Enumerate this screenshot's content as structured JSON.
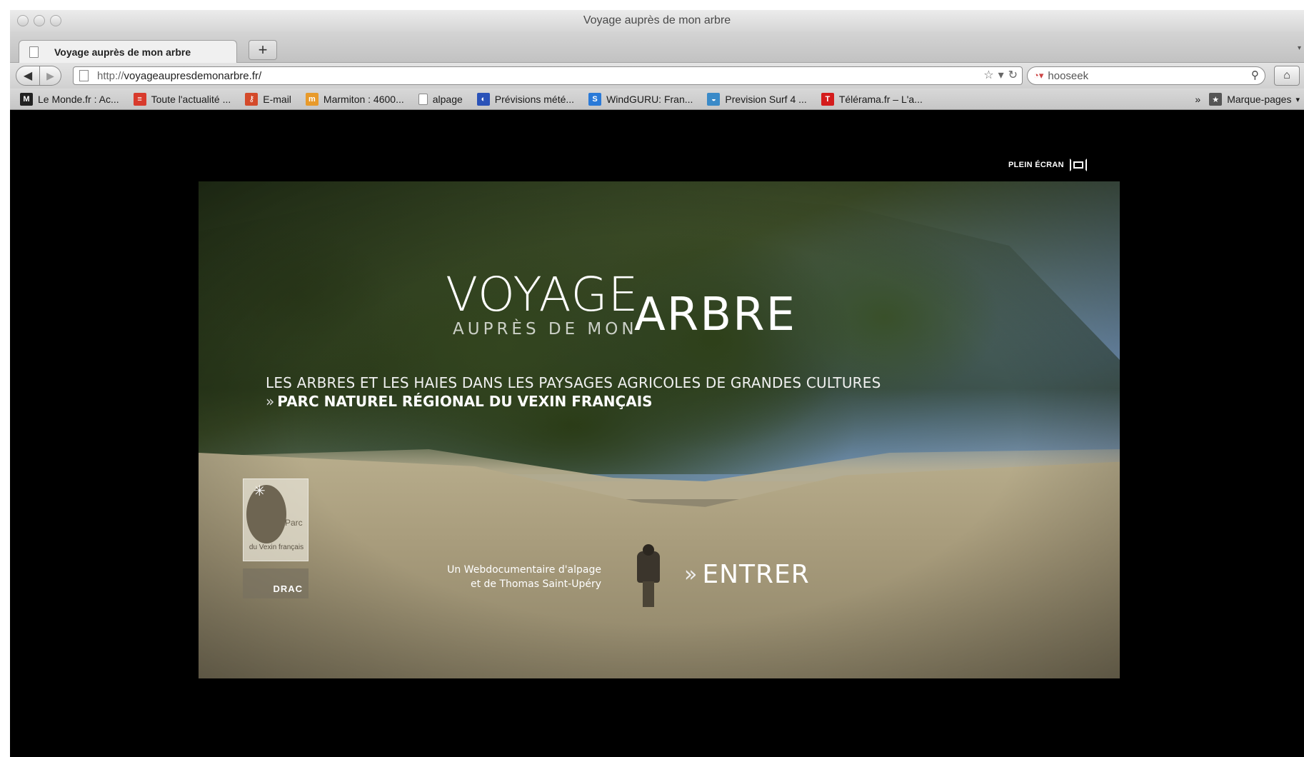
{
  "window": {
    "title": "Voyage auprès de mon arbre"
  },
  "tabs": [
    {
      "label": "Voyage auprès de mon arbre"
    }
  ],
  "toolbar": {
    "new_tab_icon": "+",
    "url": "voyageaupresdemonarbre.fr/",
    "url_protocol": "http://",
    "search_value": "hooseek",
    "back_icon": "◀",
    "forward_icon": "▶",
    "home_icon": "⌂",
    "bookmark_star_icon": "☆",
    "dropdown_icon": "▾",
    "reload_icon": "↻",
    "search_icon": "⚲"
  },
  "bookmarks": [
    {
      "label": "Le Monde.fr : Ac...",
      "icon": "M",
      "color": "#222222"
    },
    {
      "label": "Toute l'actualité ...",
      "icon": "≡",
      "color": "#d83a2c"
    },
    {
      "label": "E-mail",
      "icon": "⚷",
      "color": "#d44a2a"
    },
    {
      "label": "Marmiton : 4600...",
      "icon": "m",
      "color": "#e89a2a"
    },
    {
      "label": "alpage",
      "icon": "",
      "color": "#ffffff"
    },
    {
      "label": "Prévisions mété...",
      "icon": "◐",
      "color": "#2a52b8"
    },
    {
      "label": "WindGURU: Fran...",
      "icon": "S",
      "color": "#2a7ad8"
    },
    {
      "label": "Prevision Surf 4 ...",
      "icon": "◒",
      "color": "#3a8ac8"
    },
    {
      "label": "Télérama.fr – L'a...",
      "icon": "T",
      "color": "#d41c1c"
    }
  ],
  "bookmarks_overflow": "»",
  "bookmarks_menu": "Marque-pages",
  "page": {
    "fullscreen_label": "PLEIN ÉCRAN",
    "title_voyage": "VOYAGE",
    "title_aupres": "AUPRÈS DE MON",
    "title_arbre": "ARBRE",
    "subtitle_line1": "LES ARBRES ET LES HAIES DANS LES PAYSAGES AGRICOLES DE GRANDES CULTURES",
    "subtitle_chevron": "»",
    "subtitle_line2": "PARC NATUREL RÉGIONAL DU VEXIN FRANÇAIS",
    "logo_parc_title": "Parc",
    "logo_parc_text": "du Vexin français",
    "logo_drac": "DRAC",
    "credit_line1": "Un Webdocumentaire d'alpage",
    "credit_line2": "et de Thomas Saint-Upéry",
    "enter_chevron": "»",
    "enter_label": "ENTRER"
  }
}
